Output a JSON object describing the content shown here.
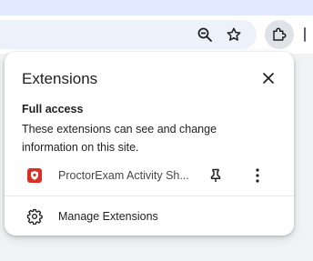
{
  "panel": {
    "title": "Extensions",
    "section_title": "Full access",
    "section_desc": "These extensions can see and change information on this site.",
    "extension": {
      "name": "ProctorExam Activity Sh...",
      "icon": "proctorexam-shield-icon",
      "icon_color": "#d93025"
    },
    "manage_label": "Manage Extensions"
  },
  "toolbar": {
    "icons": [
      "zoom-out-icon",
      "star-icon",
      "extensions-puzzle-icon"
    ]
  },
  "colors": {
    "accent_strip": "#e2e8fd",
    "omnibox": "#edf2fa",
    "icon": "#1f1f1f"
  }
}
